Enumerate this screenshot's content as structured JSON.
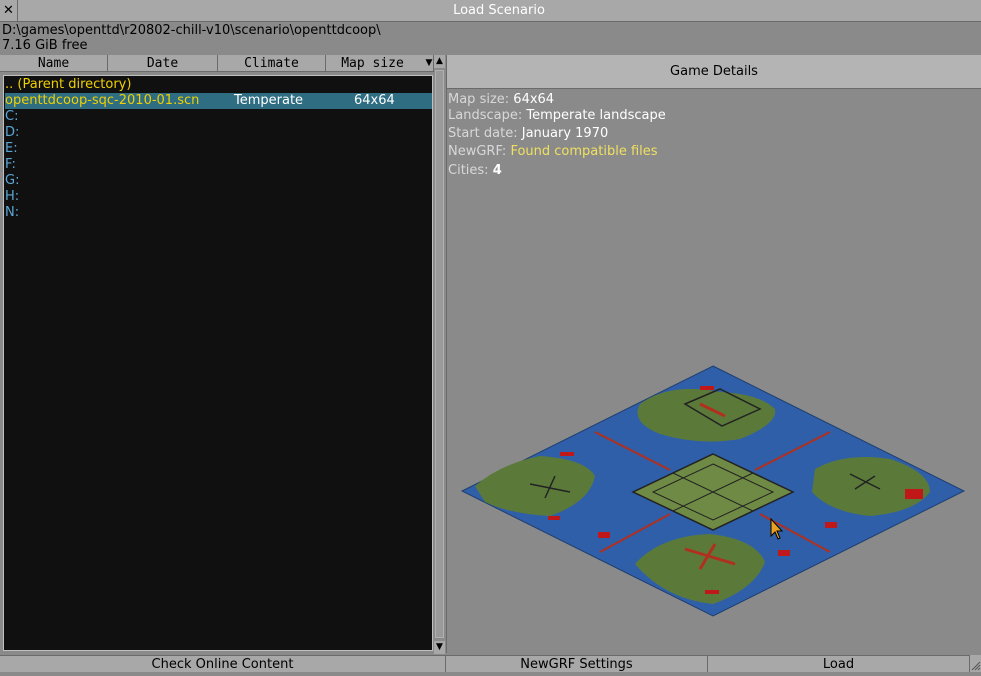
{
  "window": {
    "title": "Load Scenario",
    "close_label": "✕"
  },
  "path": {
    "directory": "D:\\games\\openttd\\r20802-chill-v10\\scenario\\openttdcoop\\",
    "free_space": "7.16 GiB free"
  },
  "columns": [
    "Name",
    "Date",
    "Climate",
    "Map size"
  ],
  "sort_indicator": "▼",
  "list": [
    {
      "name": ".. (Parent directory)",
      "type": "parent"
    },
    {
      "name": "openttdcoop-sqc-2010-01.scn",
      "type": "file",
      "climate": "Temperate",
      "map_size": "64x64",
      "selected": true
    },
    {
      "name": "C:",
      "type": "drive"
    },
    {
      "name": "D:",
      "type": "drive"
    },
    {
      "name": "E:",
      "type": "drive"
    },
    {
      "name": "F:",
      "type": "drive"
    },
    {
      "name": "G:",
      "type": "drive"
    },
    {
      "name": "H:",
      "type": "drive"
    },
    {
      "name": "N:",
      "type": "drive"
    }
  ],
  "details": {
    "header": "Game Details",
    "map_size_label": "Map size:",
    "map_size_value": "64x64",
    "landscape_label": "Landscape:",
    "landscape_value": "Temperate landscape",
    "start_date_label": "Start date:",
    "start_date_value": "January 1970",
    "newgrf_label": "NewGRF:",
    "newgrf_value": "Found compatible files",
    "cities_label": "Cities:",
    "cities_value": "4"
  },
  "buttons": {
    "check_online": "Check Online Content",
    "newgrf_settings": "NewGRF Settings",
    "load": "Load"
  },
  "scroll_up": "▲",
  "scroll_down": "▼",
  "colors": {
    "water": "#2f5fa8",
    "land": "#5b7a3a",
    "selection": "#2f6d83",
    "list_bg": "#101010",
    "file_text": "#f0d000",
    "drive_text": "#5ba8d8"
  }
}
